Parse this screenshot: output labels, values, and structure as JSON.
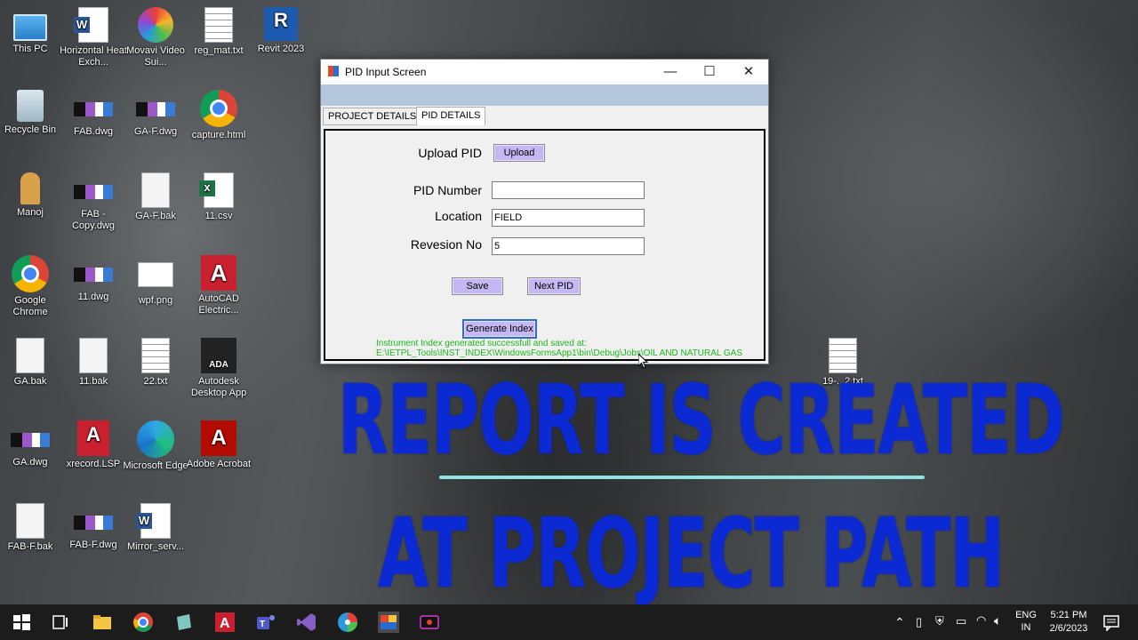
{
  "desktop_icons": [
    {
      "label": "This PC",
      "kind": "pc"
    },
    {
      "label": "Horizontal Heat Exch...",
      "kind": "word"
    },
    {
      "label": "Movavi Video Sui...",
      "kind": "movavi"
    },
    {
      "label": "reg_mat.txt",
      "kind": "txt"
    },
    {
      "label": "Revit 2023",
      "kind": "revit",
      "glyph": "R"
    },
    {
      "label": "Recycle Bin",
      "kind": "recycle"
    },
    {
      "label": "FAB.dwg",
      "kind": "dwg"
    },
    {
      "label": "GA-F.dwg",
      "kind": "dwg"
    },
    {
      "label": "capture.html",
      "kind": "chrome"
    },
    {
      "label": "Manoj",
      "kind": "user"
    },
    {
      "label": "FAB - Copy.dwg",
      "kind": "dwg"
    },
    {
      "label": "GA-F.bak",
      "kind": "blank"
    },
    {
      "label": "11.csv",
      "kind": "excel"
    },
    {
      "label": "Google Chrome",
      "kind": "chrome"
    },
    {
      "label": "11.dwg",
      "kind": "dwg"
    },
    {
      "label": "wpf.png",
      "kind": "png"
    },
    {
      "label": "AutoCAD Electric...",
      "kind": "autocad",
      "glyph": "A"
    },
    {
      "label": "GA.bak",
      "kind": "blank"
    },
    {
      "label": "11.bak",
      "kind": "blank"
    },
    {
      "label": "22.txt",
      "kind": "txt"
    },
    {
      "label": "Autodesk Desktop App",
      "kind": "ada",
      "glyph": "ADA"
    },
    {
      "label": "GA.dwg",
      "kind": "dwg"
    },
    {
      "label": "xrecord.LSP",
      "kind": "lsp",
      "glyph": "A"
    },
    {
      "label": "Microsoft Edge",
      "kind": "edge"
    },
    {
      "label": "Adobe Acrobat",
      "kind": "pdf",
      "glyph": "A"
    },
    {
      "label": "FAB-F.bak",
      "kind": "blank"
    },
    {
      "label": "FAB-F.dwg",
      "kind": "dwg"
    },
    {
      "label": "Mirror_serv...",
      "kind": "word"
    },
    {
      "label": "19-...2.txt",
      "kind": "txt"
    }
  ],
  "window": {
    "title": "PID Input Screen",
    "controls": {
      "minimize": "—",
      "maximize": "☐",
      "close": "✕"
    },
    "tabs": [
      {
        "label": "PROJECT DETAILS",
        "active": false
      },
      {
        "label": "PID DETAILS",
        "active": true
      }
    ],
    "form": {
      "upload_label": "Upload PID",
      "upload_button": "Upload",
      "pid_number_label": "PID Number",
      "pid_number_value": "",
      "location_label": "Location",
      "location_value": "FIELD",
      "revision_label": "Revesion No",
      "revision_value": "5",
      "save_button": "Save",
      "next_pid_button": "Next PID",
      "generate_button": "Generate Index",
      "status_line1": "Instrument Index generated successfull and saved at:",
      "status_line2": "E:\\IETPL_Tools\\INST_INDEX\\WindowsFormsApp1\\bin\\Debug\\Jobs\\OIL AND NATURAL GAS"
    }
  },
  "overlay": {
    "line1": "REPORT IS CREATED",
    "line2": "AT PROJECT PATH",
    "color": "#0c2ad4",
    "rule_color": "#8de6e4"
  },
  "taskbar": {
    "apps": [
      "start-icon",
      "task-view-icon",
      "file-explorer-icon",
      "chrome-icon",
      "notepad-icon",
      "autocad-icon",
      "teams-icon",
      "visual-studio-icon",
      "movavi-icon",
      "pid-app-icon",
      "screen-recorder-icon"
    ],
    "lang": "ENG",
    "region": "IN",
    "time": "5:21 PM",
    "date": "2/6/2023"
  }
}
